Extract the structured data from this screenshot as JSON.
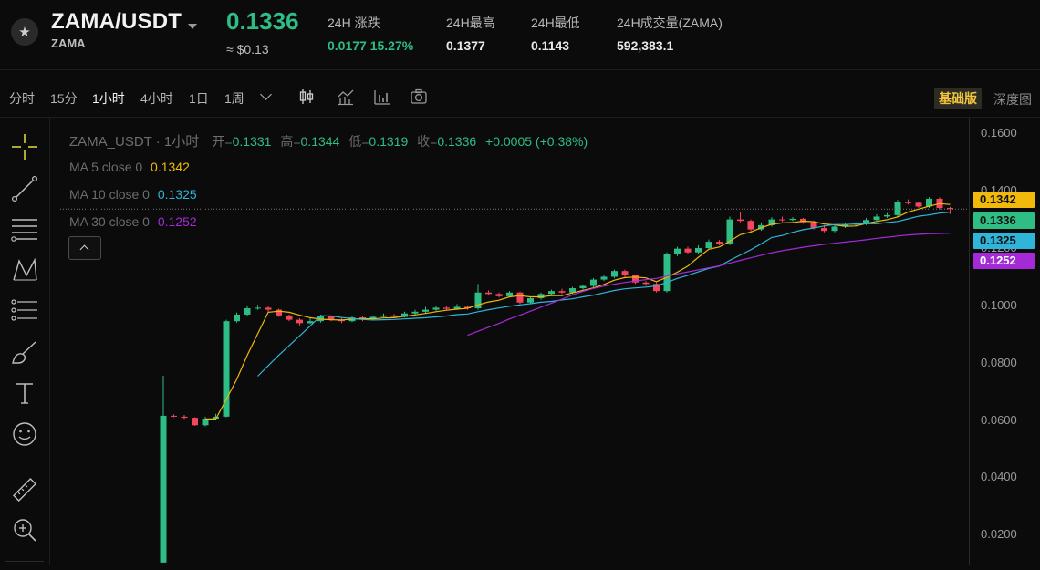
{
  "header": {
    "pair": "ZAMA/USDT",
    "base": "ZAMA",
    "last_price": "0.1336",
    "usd_price": "≈ $0.13",
    "stats": [
      {
        "label": "24H 涨跌",
        "value": "0.0177 15.27%",
        "positive": true
      },
      {
        "label": "24H最高",
        "value": "0.1377"
      },
      {
        "label": "24H最低",
        "value": "0.1143"
      },
      {
        "label": "24H成交量(ZAMA)",
        "value": "592,383.1"
      }
    ]
  },
  "toolbar": {
    "timeframes": [
      "分时",
      "15分",
      "1小时",
      "4小时",
      "1日",
      "1周"
    ],
    "active_timeframe": "1小时",
    "icons": [
      "candlestick-icon",
      "indicator-icon",
      "volume-bars-icon",
      "camera-icon"
    ],
    "basic_label": "基础版",
    "depth_label": "深度图"
  },
  "left_tools": [
    "crosshair-icon",
    "trendline-icon",
    "horizontal-lines-icon",
    "pattern-icon",
    "fib-icon",
    "brush-icon",
    "text-icon",
    "emoji-icon",
    "ruler-icon",
    "zoom-in-icon"
  ],
  "legend": {
    "symbol": "ZAMA_USDT · 1小时",
    "open_label": "开=",
    "open": "0.1331",
    "high_label": "高=",
    "high": "0.1344",
    "low_label": "低=",
    "low": "0.1319",
    "close_label": "收=",
    "close": "0.1336",
    "change": "+0.0005 (+0.38%)",
    "ma": [
      {
        "label": "MA 5 close 0",
        "value": "0.1342",
        "color": "#f0b90b"
      },
      {
        "label": "MA 10 close 0",
        "value": "0.1325",
        "color": "#2fb5d9"
      },
      {
        "label": "MA 30 close 0",
        "value": "0.1252",
        "color": "#a32ad6"
      }
    ]
  },
  "colors": {
    "up": "#2ebd85",
    "down": "#f6465d",
    "ma5": "#f0b90b",
    "ma10": "#2fb5d9",
    "ma30": "#a32ad6"
  },
  "chart_data": {
    "type": "candlestick",
    "interval": "1小时",
    "y_axis_ticks": [
      "0.1600",
      "0.1400",
      "0.1200",
      "0.1000",
      "0.0800",
      "0.0600",
      "0.0400",
      "0.0200"
    ],
    "ylim": [
      0.0093,
      0.1655
    ],
    "price_tags": [
      {
        "value": "0.1342",
        "series": "MA5"
      },
      {
        "value": "0.1336",
        "series": "last"
      },
      {
        "value": "0.1325",
        "series": "MA10"
      },
      {
        "value": "0.1252",
        "series": "MA30"
      }
    ],
    "candles": [
      [
        0.0103,
        0.0615,
        0.0755,
        0.0103
      ],
      [
        0.0615,
        0.0612,
        0.062,
        0.061
      ],
      [
        0.0612,
        0.0608,
        0.0618,
        0.0604
      ],
      [
        0.0608,
        0.0582,
        0.061,
        0.058
      ],
      [
        0.0582,
        0.0605,
        0.0612,
        0.0578
      ],
      [
        0.0605,
        0.0612,
        0.0622,
        0.06
      ],
      [
        0.0612,
        0.0945,
        0.095,
        0.061
      ],
      [
        0.0945,
        0.0968,
        0.0975,
        0.094
      ],
      [
        0.0968,
        0.099,
        0.1,
        0.0962
      ],
      [
        0.099,
        0.0992,
        0.1002,
        0.0985
      ],
      [
        0.0992,
        0.0985,
        0.0998,
        0.0978
      ],
      [
        0.0985,
        0.0965,
        0.0988,
        0.096
      ],
      [
        0.0965,
        0.095,
        0.0968,
        0.0945
      ],
      [
        0.095,
        0.0938,
        0.0955,
        0.093
      ],
      [
        0.0938,
        0.0945,
        0.0955,
        0.0935
      ],
      [
        0.0945,
        0.0962,
        0.0968,
        0.094
      ],
      [
        0.0962,
        0.095,
        0.0965,
        0.0945
      ],
      [
        0.095,
        0.0945,
        0.0955,
        0.0938
      ],
      [
        0.0945,
        0.0958,
        0.0962,
        0.0942
      ],
      [
        0.0958,
        0.0952,
        0.0962,
        0.0945
      ],
      [
        0.0952,
        0.096,
        0.0965,
        0.0948
      ],
      [
        0.096,
        0.0965,
        0.0972,
        0.0955
      ],
      [
        0.0965,
        0.096,
        0.097,
        0.0955
      ],
      [
        0.096,
        0.0972,
        0.0978,
        0.0958
      ],
      [
        0.0972,
        0.0978,
        0.0985,
        0.0965
      ],
      [
        0.0978,
        0.0985,
        0.0995,
        0.0972
      ],
      [
        0.0985,
        0.0992,
        0.1,
        0.098
      ],
      [
        0.0992,
        0.0988,
        0.0998,
        0.0985
      ],
      [
        0.0988,
        0.0995,
        0.1005,
        0.0985
      ],
      [
        0.0995,
        0.099,
        0.1,
        0.0985
      ],
      [
        0.099,
        0.1045,
        0.1075,
        0.0985
      ],
      [
        0.1045,
        0.104,
        0.1052,
        0.1035
      ],
      [
        0.104,
        0.1032,
        0.1045,
        0.1028
      ],
      [
        0.1032,
        0.1045,
        0.105,
        0.103
      ],
      [
        0.1045,
        0.101,
        0.1048,
        0.1005
      ],
      [
        0.101,
        0.1025,
        0.103,
        0.1005
      ],
      [
        0.1025,
        0.104,
        0.1045,
        0.102
      ],
      [
        0.104,
        0.105,
        0.1055,
        0.1035
      ],
      [
        0.105,
        0.1045,
        0.1058,
        0.104
      ],
      [
        0.1045,
        0.106,
        0.1065,
        0.104
      ],
      [
        0.106,
        0.1068,
        0.107,
        0.1055
      ],
      [
        0.1068,
        0.109,
        0.1095,
        0.106
      ],
      [
        0.109,
        0.11,
        0.1105,
        0.1085
      ],
      [
        0.11,
        0.112,
        0.1125,
        0.1095
      ],
      [
        0.112,
        0.1105,
        0.1125,
        0.11
      ],
      [
        0.1105,
        0.108,
        0.1108,
        0.1075
      ],
      [
        0.108,
        0.1075,
        0.1085,
        0.1068
      ],
      [
        0.1075,
        0.105,
        0.108,
        0.1045
      ],
      [
        0.105,
        0.1178,
        0.1185,
        0.1045
      ],
      [
        0.1178,
        0.1198,
        0.1205,
        0.1172
      ],
      [
        0.1198,
        0.1185,
        0.1205,
        0.118
      ],
      [
        0.1185,
        0.12,
        0.121,
        0.118
      ],
      [
        0.12,
        0.1222,
        0.123,
        0.1195
      ],
      [
        0.1222,
        0.1215,
        0.1228,
        0.121
      ],
      [
        0.1215,
        0.13,
        0.131,
        0.121
      ],
      [
        0.13,
        0.1295,
        0.1325,
        0.129
      ],
      [
        0.1295,
        0.1265,
        0.13,
        0.1258
      ],
      [
        0.1265,
        0.128,
        0.129,
        0.126
      ],
      [
        0.128,
        0.13,
        0.1308,
        0.1275
      ],
      [
        0.13,
        0.1298,
        0.131,
        0.1292
      ],
      [
        0.1298,
        0.1302,
        0.1308,
        0.1294
      ],
      [
        0.1302,
        0.129,
        0.1305,
        0.1285
      ],
      [
        0.129,
        0.127,
        0.1295,
        0.1265
      ],
      [
        0.127,
        0.126,
        0.128,
        0.1255
      ],
      [
        0.126,
        0.1275,
        0.128,
        0.1255
      ],
      [
        0.1275,
        0.1283,
        0.1288,
        0.127
      ],
      [
        0.1283,
        0.1285,
        0.129,
        0.1278
      ],
      [
        0.1285,
        0.1298,
        0.1305,
        0.128
      ],
      [
        0.1298,
        0.131,
        0.1318,
        0.1295
      ],
      [
        0.131,
        0.1315,
        0.1322,
        0.1305
      ],
      [
        0.1315,
        0.136,
        0.1368,
        0.131
      ],
      [
        0.136,
        0.1358,
        0.137,
        0.1352
      ],
      [
        0.1358,
        0.1345,
        0.1362,
        0.134
      ],
      [
        0.1345,
        0.1372,
        0.1378,
        0.134
      ],
      [
        0.1372,
        0.134,
        0.1377,
        0.1335
      ],
      [
        0.134,
        0.1336,
        0.1344,
        0.1319
      ]
    ],
    "ma5": [
      null,
      null,
      null,
      null,
      0.0604,
      0.0604,
      0.0672,
      0.0742,
      0.0826,
      0.0901,
      0.0976,
      0.098,
      0.0976,
      0.0966,
      0.0957,
      0.0952,
      0.095,
      0.0949,
      0.0952,
      0.0954,
      0.0953,
      0.0956,
      0.0957,
      0.0962,
      0.0967,
      0.0972,
      0.0978,
      0.0983,
      0.0987,
      0.099,
      0.1002,
      0.1012,
      0.1018,
      0.103,
      0.1034,
      0.103,
      0.103,
      0.1034,
      0.1034,
      0.1044,
      0.1052,
      0.1061,
      0.1073,
      0.1088,
      0.1097,
      0.1099,
      0.1096,
      0.1083,
      0.1098,
      0.1116,
      0.1137,
      0.1168,
      0.1196,
      0.1204,
      0.1224,
      0.1247,
      0.1256,
      0.1271,
      0.1283,
      0.1288,
      0.1289,
      0.1294,
      0.1292,
      0.1284,
      0.1281,
      0.1276,
      0.1277,
      0.1286,
      0.1293,
      0.1299,
      0.1309,
      0.1326,
      0.1336,
      0.1346,
      0.1355,
      0.1352
    ],
    "ma10": [
      null,
      null,
      null,
      null,
      null,
      null,
      null,
      null,
      null,
      0.0753,
      0.079,
      0.0826,
      0.086,
      0.0894,
      0.0928,
      0.0964,
      0.0963,
      0.0958,
      0.0954,
      0.0951,
      0.0949,
      0.095,
      0.0951,
      0.0953,
      0.0955,
      0.0957,
      0.096,
      0.0963,
      0.0968,
      0.097,
      0.0978,
      0.0985,
      0.0991,
      0.0997,
      0.1002,
      0.1006,
      0.1011,
      0.1014,
      0.1019,
      0.1023,
      0.103,
      0.1036,
      0.1044,
      0.1052,
      0.1058,
      0.1061,
      0.1064,
      0.1068,
      0.108,
      0.1094,
      0.1105,
      0.1117,
      0.1129,
      0.1137,
      0.1157,
      0.1176,
      0.1194,
      0.1215,
      0.1237,
      0.1244,
      0.1255,
      0.1264,
      0.127,
      0.1277,
      0.1282,
      0.1282,
      0.1284,
      0.1285,
      0.1285,
      0.1289,
      0.1293,
      0.1302,
      0.1311,
      0.1316,
      0.1322,
      0.1325
    ],
    "ma30": [
      null,
      null,
      null,
      null,
      null,
      null,
      null,
      null,
      null,
      null,
      null,
      null,
      null,
      null,
      null,
      null,
      null,
      null,
      null,
      null,
      null,
      null,
      null,
      null,
      null,
      null,
      null,
      null,
      null,
      0.0896,
      0.091,
      0.0924,
      0.0937,
      0.0953,
      0.0966,
      0.098,
      0.0994,
      0.1008,
      0.1022,
      0.1037,
      0.1049,
      0.1059,
      0.1067,
      0.1074,
      0.108,
      0.1085,
      0.109,
      0.1094,
      0.1102,
      0.111,
      0.1117,
      0.1124,
      0.1131,
      0.1138,
      0.1148,
      0.1157,
      0.1166,
      0.1175,
      0.1184,
      0.1191,
      0.1197,
      0.1203,
      0.1208,
      0.1213,
      0.1217,
      0.1221,
      0.1225,
      0.1229,
      0.1234,
      0.1238,
      0.1242,
      0.1246,
      0.1248,
      0.125,
      0.1251,
      0.1252
    ]
  }
}
